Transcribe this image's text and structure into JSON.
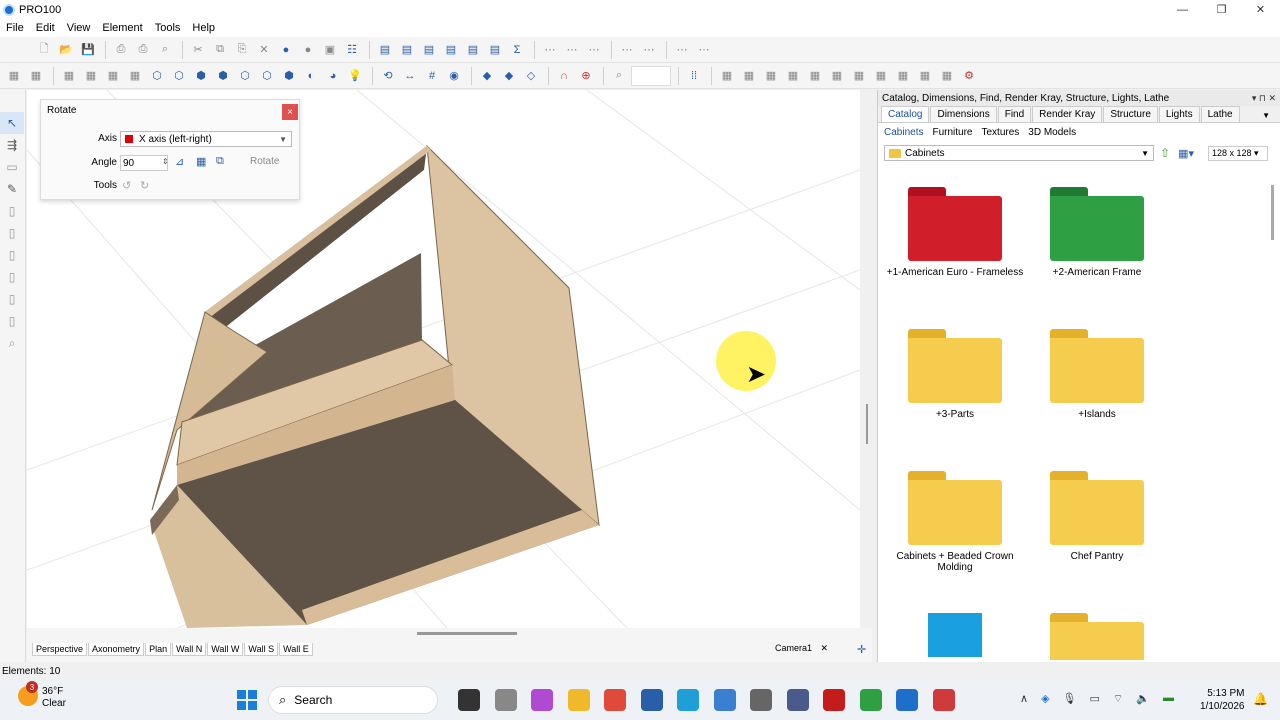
{
  "window": {
    "title": "PRO100",
    "minimize": "—",
    "maximize": "❐",
    "close": "✕"
  },
  "menu": [
    "File",
    "Edit",
    "View",
    "Element",
    "Tools",
    "Help"
  ],
  "rotate_panel": {
    "title": "Rotate",
    "close": "×",
    "axis_label": "Axis",
    "axis_value": "X axis (left-right)",
    "angle_label": "Angle",
    "angle_value": "90",
    "rotate_button": "Rotate",
    "tools_label": "Tools"
  },
  "view_tabs": [
    "Perspective",
    "Axonometry",
    "Plan",
    "Wall N",
    "Wall W",
    "Wall S",
    "Wall E"
  ],
  "camera_tab": "Camera1",
  "camera_close": "✕",
  "right_panel": {
    "header": "Catalog, Dimensions, Find, Render Kray, Structure, Lights, Lathe",
    "tabs": [
      "Catalog",
      "Dimensions",
      "Find",
      "Render Kray",
      "Structure",
      "Lights",
      "Lathe"
    ],
    "active_tab": "Catalog",
    "subtabs": [
      "Cabinets",
      "Furniture",
      "Textures",
      "3D Models"
    ],
    "folder": "Cabinets",
    "thumb_size": "128 x 128",
    "items": [
      {
        "label": "+1-American Euro - Frameless",
        "color": "#d01e2a"
      },
      {
        "label": "+2-American Frame",
        "color": "#2ea043"
      },
      {
        "label": "+3-Parts",
        "color": "#f6cc4f"
      },
      {
        "label": "+Islands",
        "color": "#f6cc4f"
      },
      {
        "label": "Cabinets + Beaded Crown Molding",
        "color": "#f6cc4f"
      },
      {
        "label": "Chef Pantry",
        "color": "#f6cc4f"
      },
      {
        "label": "",
        "color": "#1aa0e0"
      },
      {
        "label": "",
        "color": "#f6cc4f"
      }
    ]
  },
  "status": {
    "elements": "Elements: 10"
  },
  "taskbar": {
    "weather_temp": "36°F",
    "weather_desc": "Clear",
    "weather_badge": "3",
    "search_placeholder": "Search",
    "time": "5:13 PM",
    "date": "1/10/2026"
  }
}
